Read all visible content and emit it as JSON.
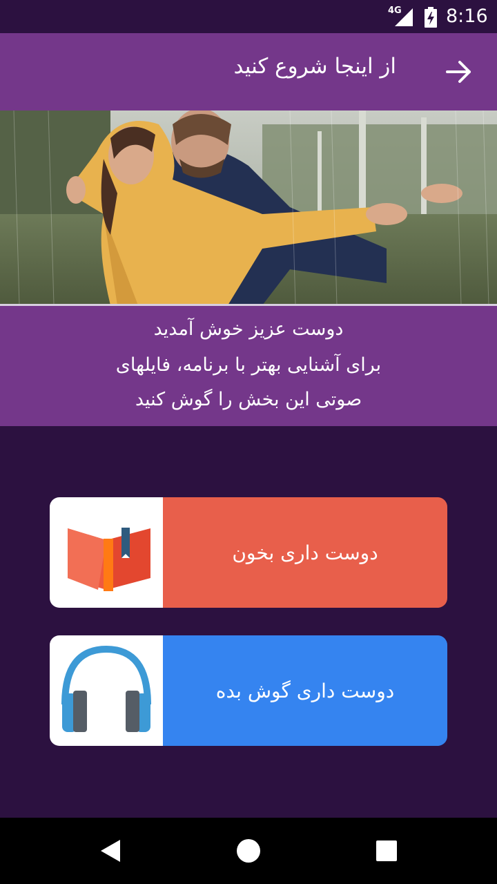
{
  "status_bar": {
    "network": "4G",
    "time": "8:16"
  },
  "app_bar": {
    "title": "از اینجا شروع کنید",
    "back_icon": "arrow-back-icon"
  },
  "hero": {
    "image": "couple-in-rain-photo"
  },
  "welcome": {
    "line1": "دوست عزیز خوش آمدید",
    "line2": "برای آشنایی بهتر با برنامه، فایلهای",
    "line3": "صوتی این بخش را گوش کنید"
  },
  "cards": [
    {
      "label": "دوست داری بخون",
      "icon": "book-icon",
      "color": "#e85f4b"
    },
    {
      "label": "دوست داری گوش بده",
      "icon": "headphones-icon",
      "color": "#3584f0"
    }
  ],
  "nav_bar": {
    "back": "nav-back-icon",
    "home": "nav-home-icon",
    "recents": "nav-recents-icon"
  },
  "colors": {
    "background": "#2c1140",
    "accent_purple": "#74378a"
  }
}
